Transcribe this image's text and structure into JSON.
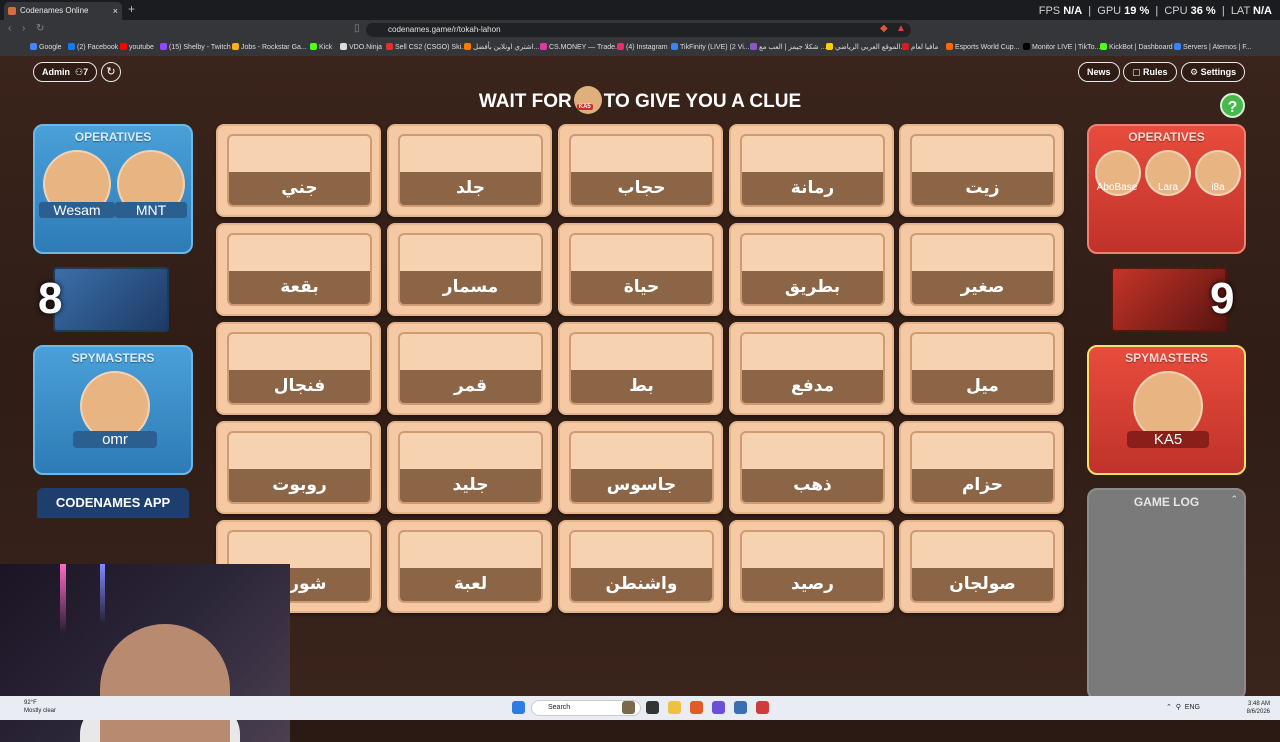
{
  "browser": {
    "tab_title": "Codenames Online",
    "tab_close": "×",
    "new_tab": "+",
    "url": "codenames.game/r/tokah-lahon",
    "perf": {
      "fps_label": "FPS",
      "fps_value": "N/A",
      "gpu_label": "GPU",
      "gpu_value": "19 %",
      "cpu_label": "CPU",
      "cpu_value": "36 %",
      "lat_label": "LAT",
      "lat_value": "N/A"
    },
    "bookmarks": [
      {
        "label": "Google",
        "color": "#4285f4"
      },
      {
        "label": "(2) Facebook",
        "color": "#1877f2"
      },
      {
        "label": "youtube",
        "color": "#ff0000"
      },
      {
        "label": "(15) Shelby - Twitch",
        "color": "#9146ff"
      },
      {
        "label": "Jobs - Rockstar Ga...",
        "color": "#fcaf17"
      },
      {
        "label": "Kick",
        "color": "#53fc18"
      },
      {
        "label": "VDO.Ninja",
        "color": "#dddddd"
      },
      {
        "label": "Sell CS2 (CSGO) Ski...",
        "color": "#e03030"
      },
      {
        "label": "اشتري اونلاين بأفضل...",
        "color": "#f57c00"
      },
      {
        "label": "CS.MONEY — Trade...",
        "color": "#d83aa8"
      },
      {
        "label": "(4) Instagram",
        "color": "#e1306c"
      },
      {
        "label": "TikFinity (LIVE) (2 Vi...",
        "color": "#3a82f7"
      },
      {
        "label": "شكلا جيمز | العب مع ...",
        "color": "#8a58c9"
      },
      {
        "label": "الموقع العربي الرياضي...",
        "color": "#fcd000"
      },
      {
        "label": "مافيا لعام",
        "color": "#cc2222"
      },
      {
        "label": "Esports World Cup...",
        "color": "#ff6a00"
      },
      {
        "label": "Monitor LIVE | TikTo...",
        "color": "#000000"
      },
      {
        "label": "KickBot | Dashboard",
        "color": "#53fc18"
      },
      {
        "label": "Servers | Aternos | F...",
        "color": "#3a82f7"
      }
    ]
  },
  "game": {
    "admin_label": "Admin",
    "players_count": "7",
    "refresh": "↻",
    "news": "News",
    "rules": "Rules",
    "settings": "Settings",
    "banner_pre": "WAIT FOR",
    "banner_post": "TO GIVE YOU A CLUE",
    "banner_player": "KA5",
    "help": "?",
    "blue_team": {
      "operatives_title": "OPERATIVES",
      "operatives": [
        "Wesam",
        "MNT"
      ],
      "remaining": "8",
      "spymasters_title": "SPYMASTERS",
      "spymaster": "omr"
    },
    "red_team": {
      "operatives_title": "OPERATIVES",
      "operatives": [
        "AboBase",
        "Lara",
        "i8a"
      ],
      "remaining": "9",
      "spymasters_title": "SPYMASTERS",
      "spymaster": "KA5"
    },
    "game_log_title": "GAME LOG",
    "app_banner": "CODENAMES APP",
    "cards": [
      "جني",
      "جلد",
      "حجاب",
      "رمانة",
      "زيت",
      "بقعة",
      "مسمار",
      "حياة",
      "بطريق",
      "صغير",
      "فنجال",
      "قمر",
      "بط",
      "مدفع",
      "ميل",
      "روبوت",
      "جليد",
      "جاسوس",
      "ذهب",
      "حزام",
      "شوربة",
      "لعبة",
      "واشنطن",
      "رصيد",
      "صولجان"
    ]
  },
  "taskbar": {
    "weather_temp": "92°F",
    "weather_desc": "Mostly clear",
    "search": "Search",
    "lang": "ENG",
    "time": "3:48 AM",
    "date": "8/6/2026"
  }
}
